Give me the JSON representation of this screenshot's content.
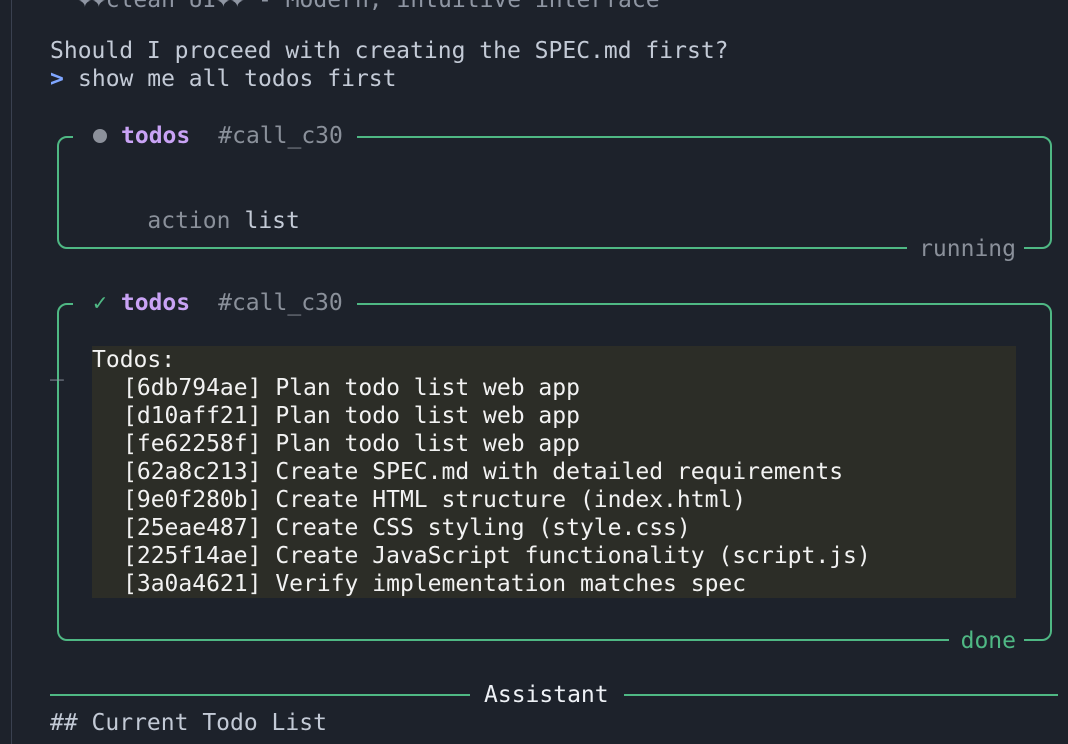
{
  "transcript": {
    "clipped_line": "✦✦clean UI✦✦ - Modern, intuitive interface",
    "question": "Should I proceed with creating the SPEC.md first?",
    "prompt_symbol": ">",
    "user_input": "show me all todos first"
  },
  "tool_calls": [
    {
      "state_icon": "dot-icon",
      "name": "todos",
      "call_id": "#call_c30",
      "arg_key": "action",
      "arg_value": "list",
      "status": "running"
    },
    {
      "state_icon": "check-icon",
      "check_glyph": "✓",
      "name": "todos",
      "call_id": "#call_c30",
      "status": "done",
      "cursor_glyph": "_",
      "output": {
        "title": "Todos:",
        "items": [
          "[6db794ae] Plan todo list web app",
          "[d10aff21] Plan todo list web app",
          "[fe62258f] Plan todo list web app",
          "[62a8c213] Create SPEC.md with detailed requirements",
          "[9e0f280b] Create HTML structure (index.html)",
          "[25eae487] Create CSS styling (style.css)",
          "[225f14ae] Create JavaScript functionality (script.js)",
          "[3a0a4621] Verify implementation matches spec"
        ]
      }
    }
  ],
  "assistant": {
    "divider_title": "Assistant",
    "heading": "## Current Todo List"
  },
  "colors": {
    "background": "#1d222b",
    "accent_green": "#4fb884",
    "tool_name_purple": "#c9a3f5",
    "prompt_blue": "#7fa6ff",
    "output_background": "#2c2d27"
  }
}
